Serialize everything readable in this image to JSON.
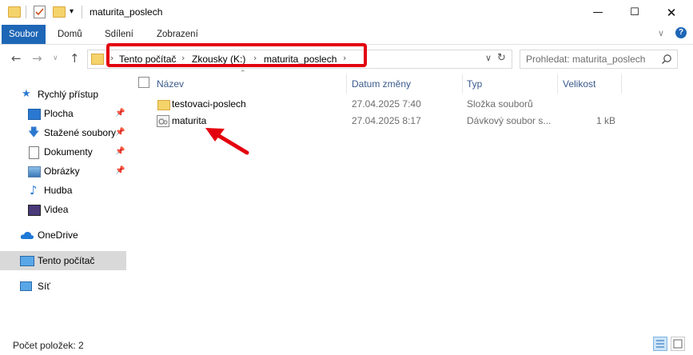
{
  "window": {
    "title": "maturita_poslech",
    "controls": [
      "minimize-icon",
      "maximize-icon",
      "close-icon"
    ]
  },
  "ribbon": {
    "tabs": [
      {
        "label": "Soubor",
        "active": true
      },
      {
        "label": "Domů"
      },
      {
        "label": "Sdílení"
      },
      {
        "label": "Zobrazení"
      }
    ]
  },
  "address": {
    "breadcrumbs": [
      "Tento počítač",
      "Zkousky (K:)",
      "maturita_poslech"
    ],
    "search_placeholder": "Prohledat: maturita_poslech"
  },
  "sidebar": {
    "quick_access": {
      "label": "Rychlý přístup"
    },
    "items": [
      {
        "label": "Plocha",
        "pinned": true,
        "icon": "desktop-icon"
      },
      {
        "label": "Stažené soubory",
        "pinned": true,
        "icon": "download-icon"
      },
      {
        "label": "Dokumenty",
        "pinned": true,
        "icon": "document-icon"
      },
      {
        "label": "Obrázky",
        "pinned": true,
        "icon": "pictures-icon"
      },
      {
        "label": "Hudba",
        "pinned": false,
        "icon": "music-icon"
      },
      {
        "label": "Videa",
        "pinned": false,
        "icon": "video-icon"
      }
    ],
    "onedrive": {
      "label": "OneDrive"
    },
    "this_pc": {
      "label": "Tento počítač",
      "selected": true
    },
    "network": {
      "label": "Síť"
    }
  },
  "file_list": {
    "columns": [
      "Název",
      "Datum změny",
      "Typ",
      "Velikost"
    ],
    "rows": [
      {
        "name": "testovaci-poslech",
        "modified": "27.04.2025 7:40",
        "type": "Složka souborů",
        "size": "",
        "icon": "folder-icon"
      },
      {
        "name": "maturita",
        "modified": "27.04.2025 8:17",
        "type": "Dávkový soubor s...",
        "size": "1 kB",
        "icon": "batch-file-icon"
      }
    ]
  },
  "status": {
    "item_count": "Počet položek: 2"
  },
  "colors": {
    "accent": "#1e66b6",
    "highlight": "#e3000f",
    "folder": "#f5d36b"
  }
}
